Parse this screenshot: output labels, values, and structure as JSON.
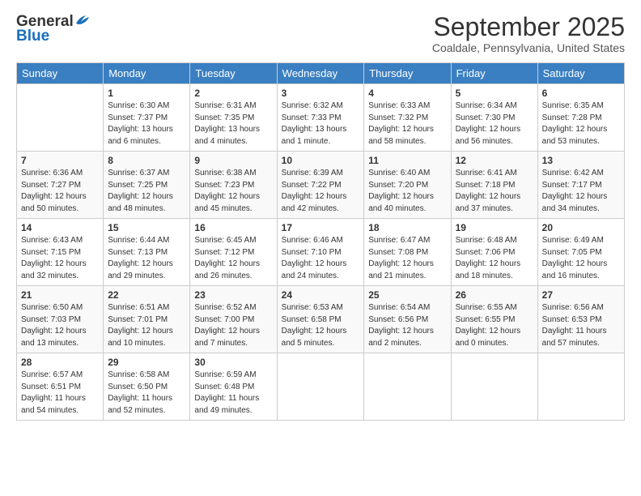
{
  "logo": {
    "general": "General",
    "blue": "Blue"
  },
  "title": "September 2025",
  "subtitle": "Coaldale, Pennsylvania, United States",
  "days_of_week": [
    "Sunday",
    "Monday",
    "Tuesday",
    "Wednesday",
    "Thursday",
    "Friday",
    "Saturday"
  ],
  "weeks": [
    [
      {
        "day": "",
        "content": ""
      },
      {
        "day": "1",
        "content": "Sunrise: 6:30 AM\nSunset: 7:37 PM\nDaylight: 13 hours\nand 6 minutes."
      },
      {
        "day": "2",
        "content": "Sunrise: 6:31 AM\nSunset: 7:35 PM\nDaylight: 13 hours\nand 4 minutes."
      },
      {
        "day": "3",
        "content": "Sunrise: 6:32 AM\nSunset: 7:33 PM\nDaylight: 13 hours\nand 1 minute."
      },
      {
        "day": "4",
        "content": "Sunrise: 6:33 AM\nSunset: 7:32 PM\nDaylight: 12 hours\nand 58 minutes."
      },
      {
        "day": "5",
        "content": "Sunrise: 6:34 AM\nSunset: 7:30 PM\nDaylight: 12 hours\nand 56 minutes."
      },
      {
        "day": "6",
        "content": "Sunrise: 6:35 AM\nSunset: 7:28 PM\nDaylight: 12 hours\nand 53 minutes."
      }
    ],
    [
      {
        "day": "7",
        "content": "Sunrise: 6:36 AM\nSunset: 7:27 PM\nDaylight: 12 hours\nand 50 minutes."
      },
      {
        "day": "8",
        "content": "Sunrise: 6:37 AM\nSunset: 7:25 PM\nDaylight: 12 hours\nand 48 minutes."
      },
      {
        "day": "9",
        "content": "Sunrise: 6:38 AM\nSunset: 7:23 PM\nDaylight: 12 hours\nand 45 minutes."
      },
      {
        "day": "10",
        "content": "Sunrise: 6:39 AM\nSunset: 7:22 PM\nDaylight: 12 hours\nand 42 minutes."
      },
      {
        "day": "11",
        "content": "Sunrise: 6:40 AM\nSunset: 7:20 PM\nDaylight: 12 hours\nand 40 minutes."
      },
      {
        "day": "12",
        "content": "Sunrise: 6:41 AM\nSunset: 7:18 PM\nDaylight: 12 hours\nand 37 minutes."
      },
      {
        "day": "13",
        "content": "Sunrise: 6:42 AM\nSunset: 7:17 PM\nDaylight: 12 hours\nand 34 minutes."
      }
    ],
    [
      {
        "day": "14",
        "content": "Sunrise: 6:43 AM\nSunset: 7:15 PM\nDaylight: 12 hours\nand 32 minutes."
      },
      {
        "day": "15",
        "content": "Sunrise: 6:44 AM\nSunset: 7:13 PM\nDaylight: 12 hours\nand 29 minutes."
      },
      {
        "day": "16",
        "content": "Sunrise: 6:45 AM\nSunset: 7:12 PM\nDaylight: 12 hours\nand 26 minutes."
      },
      {
        "day": "17",
        "content": "Sunrise: 6:46 AM\nSunset: 7:10 PM\nDaylight: 12 hours\nand 24 minutes."
      },
      {
        "day": "18",
        "content": "Sunrise: 6:47 AM\nSunset: 7:08 PM\nDaylight: 12 hours\nand 21 minutes."
      },
      {
        "day": "19",
        "content": "Sunrise: 6:48 AM\nSunset: 7:06 PM\nDaylight: 12 hours\nand 18 minutes."
      },
      {
        "day": "20",
        "content": "Sunrise: 6:49 AM\nSunset: 7:05 PM\nDaylight: 12 hours\nand 16 minutes."
      }
    ],
    [
      {
        "day": "21",
        "content": "Sunrise: 6:50 AM\nSunset: 7:03 PM\nDaylight: 12 hours\nand 13 minutes."
      },
      {
        "day": "22",
        "content": "Sunrise: 6:51 AM\nSunset: 7:01 PM\nDaylight: 12 hours\nand 10 minutes."
      },
      {
        "day": "23",
        "content": "Sunrise: 6:52 AM\nSunset: 7:00 PM\nDaylight: 12 hours\nand 7 minutes."
      },
      {
        "day": "24",
        "content": "Sunrise: 6:53 AM\nSunset: 6:58 PM\nDaylight: 12 hours\nand 5 minutes."
      },
      {
        "day": "25",
        "content": "Sunrise: 6:54 AM\nSunset: 6:56 PM\nDaylight: 12 hours\nand 2 minutes."
      },
      {
        "day": "26",
        "content": "Sunrise: 6:55 AM\nSunset: 6:55 PM\nDaylight: 12 hours\nand 0 minutes."
      },
      {
        "day": "27",
        "content": "Sunrise: 6:56 AM\nSunset: 6:53 PM\nDaylight: 11 hours\nand 57 minutes."
      }
    ],
    [
      {
        "day": "28",
        "content": "Sunrise: 6:57 AM\nSunset: 6:51 PM\nDaylight: 11 hours\nand 54 minutes."
      },
      {
        "day": "29",
        "content": "Sunrise: 6:58 AM\nSunset: 6:50 PM\nDaylight: 11 hours\nand 52 minutes."
      },
      {
        "day": "30",
        "content": "Sunrise: 6:59 AM\nSunset: 6:48 PM\nDaylight: 11 hours\nand 49 minutes."
      },
      {
        "day": "",
        "content": ""
      },
      {
        "day": "",
        "content": ""
      },
      {
        "day": "",
        "content": ""
      },
      {
        "day": "",
        "content": ""
      }
    ]
  ]
}
